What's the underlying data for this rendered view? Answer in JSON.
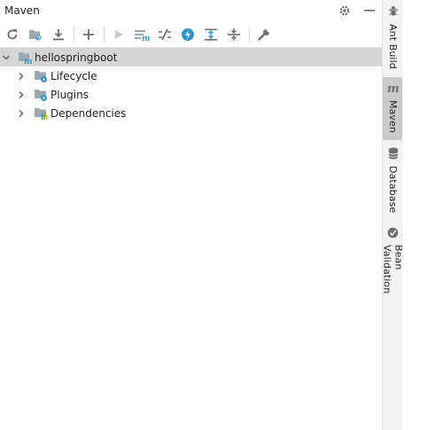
{
  "window": {
    "title": "Maven"
  },
  "title_actions": [
    {
      "icon": "gear-icon"
    },
    {
      "icon": "minimize-icon"
    }
  ],
  "toolbar": {
    "buttons": [
      {
        "icon": "reload-icon"
      },
      {
        "icon": "generate-sources-icon"
      },
      {
        "icon": "download-icon"
      },
      {
        "icon": "add-icon"
      },
      {
        "icon": "run-icon"
      },
      {
        "icon": "execute-goal-icon"
      },
      {
        "icon": "toggle-offline-icon"
      },
      {
        "icon": "skip-tests-icon"
      },
      {
        "icon": "expand-all-icon"
      },
      {
        "icon": "collapse-all-icon"
      },
      {
        "icon": "settings-wrench-icon"
      }
    ]
  },
  "tree": {
    "root": {
      "label": "hellospringboot",
      "expanded": true
    },
    "children": [
      {
        "label": "Lifecycle",
        "icon": "folder-gear-icon"
      },
      {
        "label": "Plugins",
        "icon": "folder-gear-icon"
      },
      {
        "label": "Dependencies",
        "icon": "folder-dependencies-icon"
      }
    ]
  },
  "right_stripe": [
    {
      "label": "Ant Build",
      "icon": "ant-icon",
      "active": false
    },
    {
      "label": "Maven",
      "icon": "maven-icon",
      "active": true
    },
    {
      "label": "Database",
      "icon": "database-icon",
      "active": false
    },
    {
      "label": "Bean Validation",
      "icon": "bean-validation-icon",
      "active": false
    }
  ],
  "colors": {
    "accent_blue": "#3592c4",
    "icon_gray": "#6e6e6e",
    "selection": "#d5d5d5",
    "stripe_active": "#c9c9c9"
  }
}
